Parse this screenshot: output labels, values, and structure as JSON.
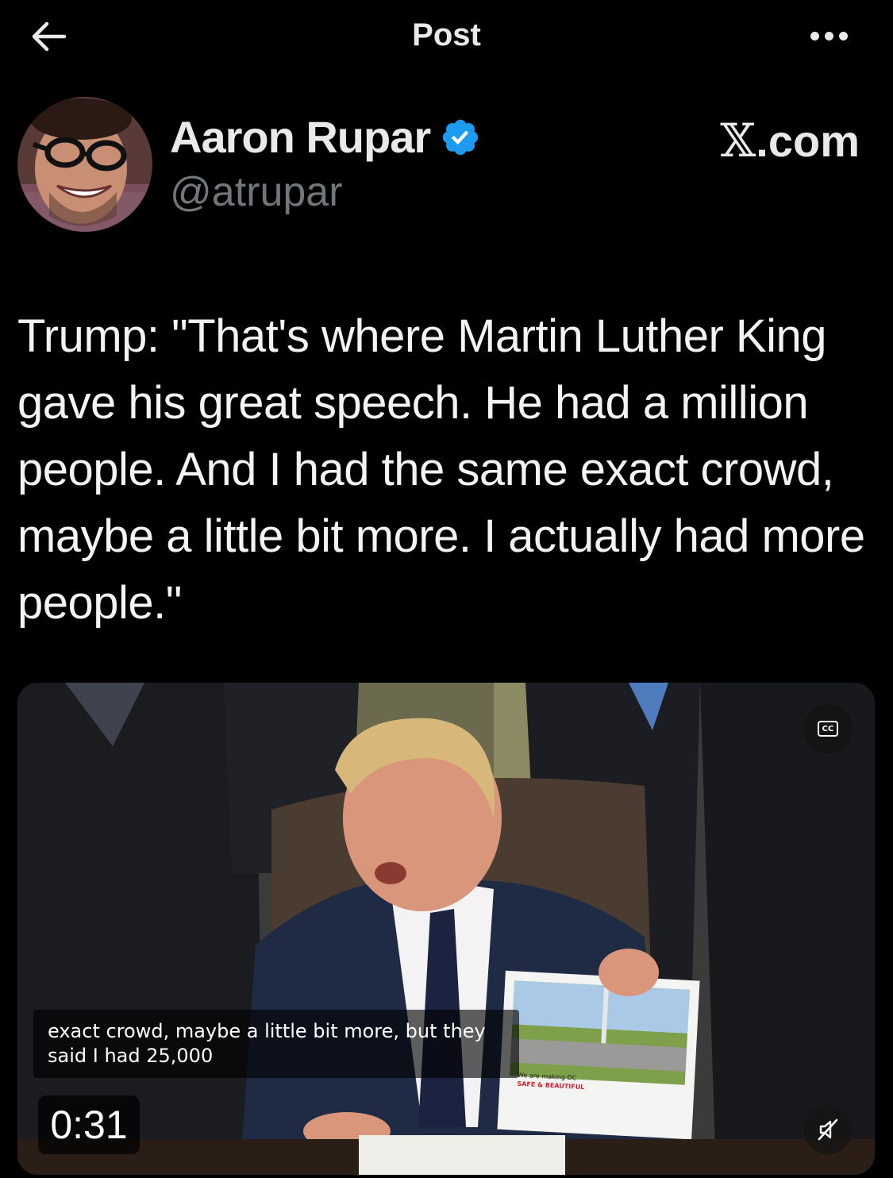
{
  "header": {
    "title": "Post",
    "back_icon": "arrow-left-icon",
    "more_icon": "more-horizontal-icon"
  },
  "author": {
    "name": "Aaron Rupar",
    "handle": "@atrupar",
    "verified": true,
    "verified_color": "#1d9bf0"
  },
  "source": {
    "label": ".com",
    "logo_glyph": "𝕏"
  },
  "post": {
    "text": "Trump: \"That's where Martin Luther King gave his great speech. He had a million people. And I had the same exact crowd, maybe a little bit more. I actually had more people.\""
  },
  "video": {
    "caption_line1": "exact crowd, maybe a little bit more, but they",
    "caption_line2": "said I had 25,000",
    "timestamp": "0:31",
    "cc_label": "CC",
    "poster_text_1": "We are making DC",
    "poster_text_2": "SAFE & BEAUTIFUL"
  },
  "colors": {
    "background": "#000000",
    "text": "#e7e9ea",
    "secondary_text": "#71767b",
    "accent": "#1d9bf0"
  }
}
